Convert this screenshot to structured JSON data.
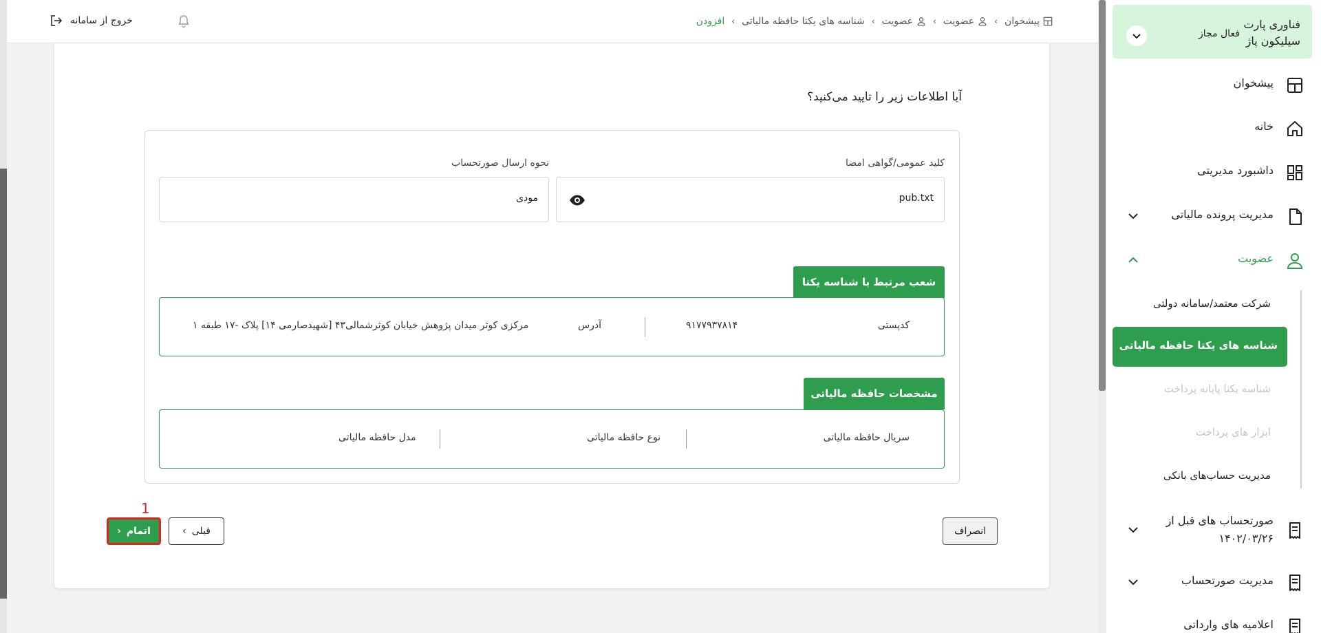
{
  "breadcrumb": {
    "items": [
      {
        "label": "پیشخوان"
      },
      {
        "label": "عضویت"
      },
      {
        "label": "عضویت"
      },
      {
        "label": "شناسه های یکتا حافظه مالیاتی"
      },
      {
        "label": "افزودن"
      }
    ]
  },
  "header": {
    "logout_label": "خروج از سامانه"
  },
  "form": {
    "question": "آیا اطلاعات زیر را تایید می‌کنید؟",
    "public_key_label": "کلید عمومی/گواهی امضا",
    "public_key_value": "pub.txt",
    "invoice_send_label": "نحوه ارسال صورتحساب",
    "invoice_send_value": "مودی"
  },
  "branches": {
    "title": "شعب مرتبط با شناسه یکتا",
    "postal_code_label": "کدپستی",
    "postal_code_value": "۹۱۷۷۹۳۷۸۱۴",
    "address_label": "آدرس",
    "address_value": "مرکزی کوثر میدان پژوهش خیابان کوثرشمالی۴۳ [شهیدصارمی ۱۴] پلاک -۱۷ طبقه ۱"
  },
  "memory": {
    "title": "مشخصات حافظه مالیاتی",
    "serial_label": "سریال حافظه مالیاتی",
    "type_label": "نوع حافظه مالیاتی",
    "model_label": "مدل حافظه مالیاتی"
  },
  "buttons": {
    "cancel": "انصراف",
    "previous": "قبلی",
    "finish": "اتمام",
    "marker": "1"
  },
  "sidebar": {
    "company_name": "فناوری پارت سیلیکون پاژ",
    "company_status": "فعال مجاز",
    "items": [
      {
        "label": "پیشخوان",
        "icon": "dashboard-icon"
      },
      {
        "label": "خانه",
        "icon": "home-icon"
      },
      {
        "label": "داشبورد مدیریتی",
        "icon": "grid-icon"
      },
      {
        "label": "مدیریت پرونده مالیاتی",
        "icon": "file-icon"
      },
      {
        "label": "عضویت",
        "icon": "user-icon"
      }
    ],
    "sub_items": [
      {
        "label": "شرکت معتمد/سامانه دولتی"
      },
      {
        "label": "شناسه های یکتا حافظه مالیاتی"
      },
      {
        "label": "شناسه یکتا پایانه پرداخت"
      },
      {
        "label": "ابزار های پرداخت"
      },
      {
        "label": "مدیریت حساب‌های بانکی"
      }
    ],
    "bottom_items": [
      {
        "label": "صورتحساب های قبل از ۱۴۰۲/۰۳/۲۶",
        "icon": "receipt-icon"
      },
      {
        "label": "مدیریت صورتحساب",
        "icon": "receipt-icon"
      },
      {
        "label": "اعلامیه های وارداتی",
        "icon": "receipt-icon"
      }
    ]
  },
  "colors": {
    "accent": "#2e9d4d",
    "highlight": "#e02424",
    "company_bg": "#d7f5dc"
  }
}
